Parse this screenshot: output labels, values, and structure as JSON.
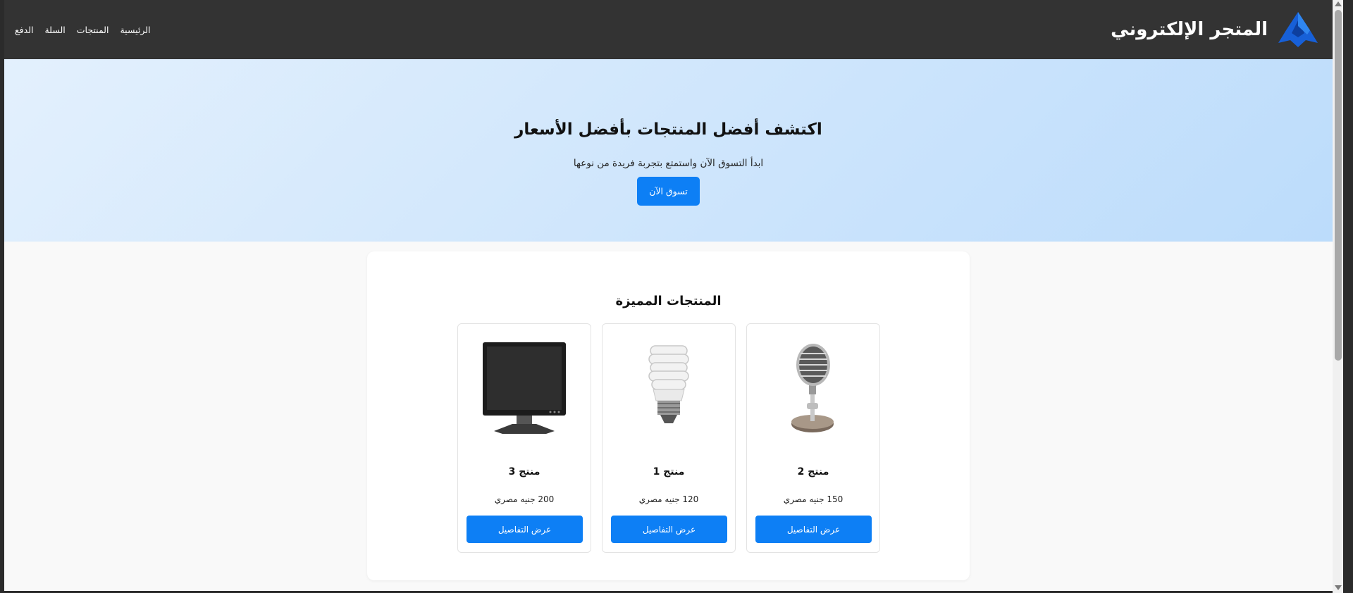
{
  "header": {
    "brand_title": "المتجر الإلكتروني",
    "logo_icon": "blue-arrow-logo-icon",
    "nav": [
      "الرئيسية",
      "المنتجات",
      "السلة",
      "الدفع"
    ]
  },
  "hero": {
    "title": "اكتشف أفضل المنتجات بأفضل الأسعار",
    "subtitle": "ابدأ التسوق الآن واستمتع بتجربة فريدة من نوعها",
    "cta_label": "تسوق الآن"
  },
  "featured": {
    "title": "المنتجات المميزة",
    "products": [
      {
        "name": "منتج 2",
        "price": "150 جنيه مصري",
        "button": "عرض التفاصيل",
        "image_icon": "microphone-icon"
      },
      {
        "name": "منتج 1",
        "price": "120 جنيه مصري",
        "button": "عرض التفاصيل",
        "image_icon": "light-bulb-icon"
      },
      {
        "name": "منتج 3",
        "price": "200 جنيه مصري",
        "button": "عرض التفاصيل",
        "image_icon": "monitor-icon"
      }
    ]
  },
  "colors": {
    "header_bg": "#333333",
    "accent": "#0d7ff5",
    "hero_gradient_start": "#e3f0fd",
    "hero_gradient_end": "#bcdcfb",
    "page_bg": "#f9f9f9"
  }
}
